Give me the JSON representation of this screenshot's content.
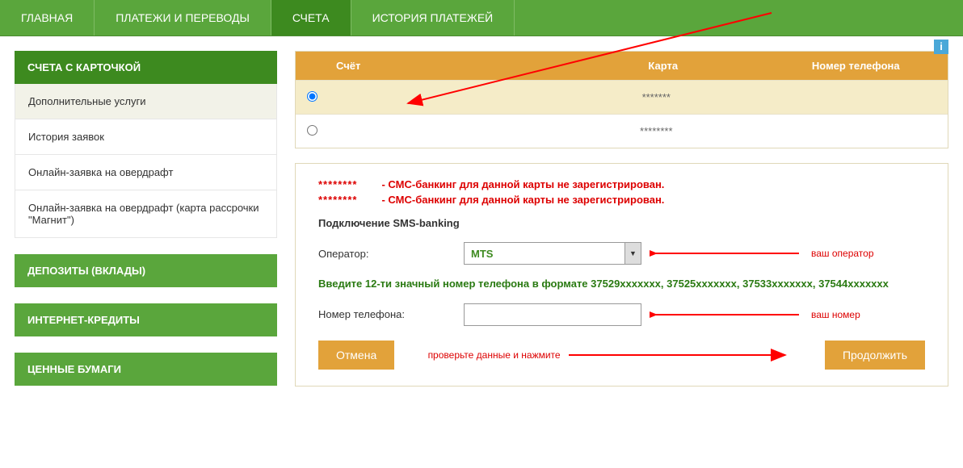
{
  "topnav": {
    "items": [
      "ГЛАВНАЯ",
      "ПЛАТЕЖИ И ПЕРЕВОДЫ",
      "СЧЕТА",
      "ИСТОРИЯ ПЛАТЕЖЕЙ"
    ],
    "active": 2
  },
  "sidebar": {
    "head": "СЧЕТА С КАРТОЧКОЙ",
    "items": [
      "Дополнительные услуги",
      "История заявок",
      "Онлайн-заявка на овердрафт",
      "Онлайн-заявка на овердрафт (карта рассрочки \"Магнит\")"
    ],
    "active": 0,
    "blocks": [
      "ДЕПОЗИТЫ (ВКЛАДЫ)",
      "ИНТЕРНЕТ-КРЕДИТЫ",
      "ЦЕННЫЕ БУМАГИ"
    ]
  },
  "info_badge": "i",
  "table": {
    "headers": {
      "account": "Счёт",
      "card": "Карта",
      "phone": "Номер телефона"
    },
    "rows": [
      {
        "card_mask": "*******",
        "selected": true
      },
      {
        "card_mask": "********",
        "selected": false
      }
    ]
  },
  "warnings": [
    {
      "mask": "********",
      "text": "- СМС-банкинг для данной карты не зарегистрирован."
    },
    {
      "mask": "********",
      "text": "- СМС-банкинг для данной карты не зарегистрирован."
    }
  ],
  "sms": {
    "title": "Подключение SMS-banking",
    "operator_label": "Оператор:",
    "operator_value": "MTS",
    "hint": "Введите 12-ти значный номер телефона в формате 37529xxxxxxx, 37525xxxxxxx, 37533xxxxxxx, 37544xxxxxxx",
    "phone_label": "Номер телефона:",
    "phone_value": ""
  },
  "buttons": {
    "cancel": "Отмена",
    "continue": "Продолжить"
  },
  "annotations": {
    "operator": "ваш оператор",
    "phone": "ваш номер",
    "check": "проверьте данные и нажмите"
  }
}
